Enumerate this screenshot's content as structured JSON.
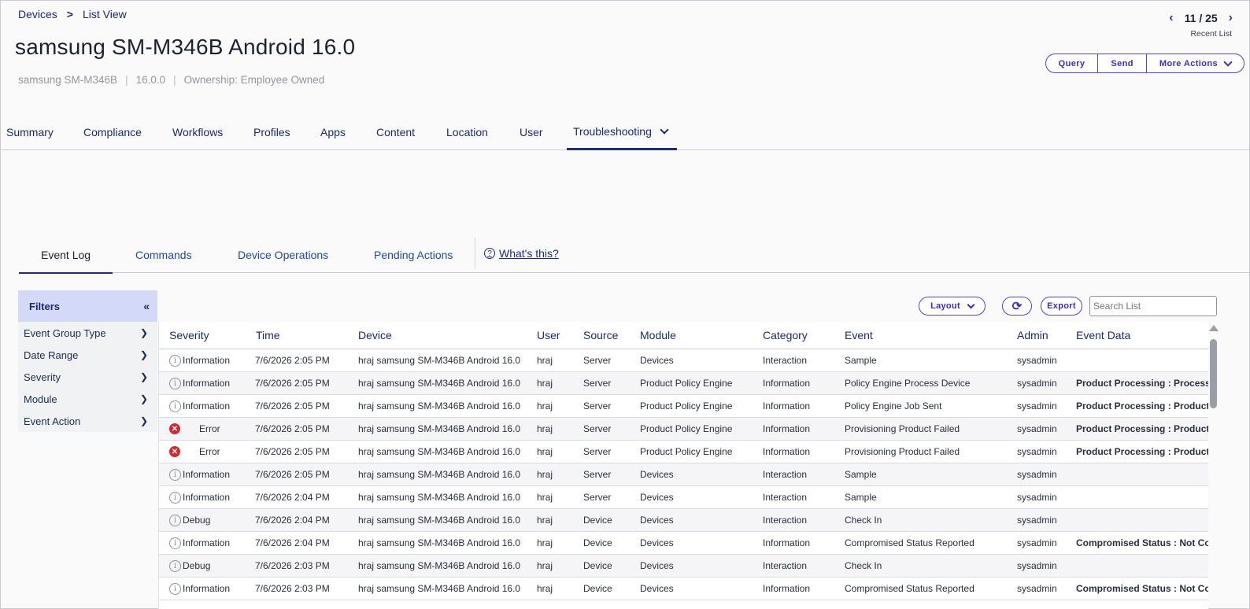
{
  "breadcrumb": {
    "devices": "Devices",
    "separator": ">",
    "list_view": "List View"
  },
  "page_title": "samsung SM-M346B Android 16.0",
  "meta": {
    "model": "samsung SM-M346B",
    "version": "16.0.0",
    "ownership": "Ownership: Employee Owned",
    "separator": "|"
  },
  "pager": {
    "position": "11 / 25",
    "recent": "Recent List"
  },
  "actions": {
    "query": "Query",
    "send": "Send",
    "more": "More Actions"
  },
  "tabs": [
    "Summary",
    "Compliance",
    "Workflows",
    "Profiles",
    "Apps",
    "Content",
    "Location",
    "User",
    "Troubleshooting"
  ],
  "subtabs": [
    "Event Log",
    "Commands",
    "Device Operations",
    "Pending Actions"
  ],
  "whats_this": "What's this?",
  "filters": {
    "title": "Filters",
    "items": [
      "Event Group Type",
      "Date Range",
      "Severity",
      "Module",
      "Event Action"
    ]
  },
  "toolbar": {
    "layout": "Layout",
    "export": "Export",
    "search_placeholder": "Search List"
  },
  "table": {
    "columns": [
      "Severity",
      "Time",
      "Device",
      "User",
      "Source",
      "Module",
      "Category",
      "Event",
      "Admin",
      "Event Data"
    ],
    "rows": [
      {
        "severity": "Information",
        "type": "info",
        "time": "7/6/2026 2:05 PM",
        "device": "hraj samsung SM-M346B Android 16.0",
        "user": "hraj",
        "source": "Server",
        "module": "Devices",
        "category": "Interaction",
        "event": "Sample",
        "admin": "sysadmin",
        "event_data": ""
      },
      {
        "severity": "Information",
        "type": "info",
        "time": "7/6/2026 2:05 PM",
        "device": "hraj samsung SM-M346B Android 16.0",
        "user": "hraj",
        "source": "Server",
        "module": "Product Policy Engine",
        "category": "Information",
        "event": "Policy Engine Process Device",
        "admin": "sysadmin",
        "event_data": "Product Processing : Processing"
      },
      {
        "severity": "Information",
        "type": "info",
        "time": "7/6/2026 2:05 PM",
        "device": "hraj samsung SM-M346B Android 16.0",
        "user": "hraj",
        "source": "Server",
        "module": "Product Policy Engine",
        "category": "Information",
        "event": "Policy Engine Job Sent",
        "admin": "sysadmin",
        "event_data": "Product Processing : ProductID:"
      },
      {
        "severity": "Error",
        "type": "error",
        "time": "7/6/2026 2:05 PM",
        "device": "hraj samsung SM-M346B Android 16.0",
        "user": "hraj",
        "source": "Server",
        "module": "Product Policy Engine",
        "category": "Information",
        "event": "Provisioning Product Failed",
        "admin": "sysadmin",
        "event_data": "Product Processing : Product Ex"
      },
      {
        "severity": "Error",
        "type": "error",
        "time": "7/6/2026 2:05 PM",
        "device": "hraj samsung SM-M346B Android 16.0",
        "user": "hraj",
        "source": "Server",
        "module": "Product Policy Engine",
        "category": "Information",
        "event": "Provisioning Product Failed",
        "admin": "sysadmin",
        "event_data": "Product Processing : Product Ex"
      },
      {
        "severity": "Information",
        "type": "info",
        "time": "7/6/2026 2:05 PM",
        "device": "hraj samsung SM-M346B Android 16.0",
        "user": "hraj",
        "source": "Server",
        "module": "Devices",
        "category": "Interaction",
        "event": "Sample",
        "admin": "sysadmin",
        "event_data": ""
      },
      {
        "severity": "Information",
        "type": "info",
        "time": "7/6/2026 2:04 PM",
        "device": "hraj samsung SM-M346B Android 16.0",
        "user": "hraj",
        "source": "Server",
        "module": "Devices",
        "category": "Interaction",
        "event": "Sample",
        "admin": "sysadmin",
        "event_data": ""
      },
      {
        "severity": "Debug",
        "type": "info",
        "time": "7/6/2026 2:04 PM",
        "device": "hraj samsung SM-M346B Android 16.0",
        "user": "hraj",
        "source": "Device",
        "module": "Devices",
        "category": "Interaction",
        "event": "Check In",
        "admin": "sysadmin",
        "event_data": ""
      },
      {
        "severity": "Information",
        "type": "info",
        "time": "7/6/2026 2:04 PM",
        "device": "hraj samsung SM-M346B Android 16.0",
        "user": "hraj",
        "source": "Device",
        "module": "Devices",
        "category": "Information",
        "event": "Compromised Status Reported",
        "admin": "sysadmin",
        "event_data": "Compromised Status : Not Comp"
      },
      {
        "severity": "Debug",
        "type": "info",
        "time": "7/6/2026 2:03 PM",
        "device": "hraj samsung SM-M346B Android 16.0",
        "user": "hraj",
        "source": "Device",
        "module": "Devices",
        "category": "Interaction",
        "event": "Check In",
        "admin": "sysadmin",
        "event_data": ""
      },
      {
        "severity": "Information",
        "type": "info",
        "time": "7/6/2026 2:03 PM",
        "device": "hraj samsung SM-M346B Android 16.0",
        "user": "hraj",
        "source": "Device",
        "module": "Devices",
        "category": "Information",
        "event": "Compromised Status Reported",
        "admin": "sysadmin",
        "event_data": "Compromised Status : Not Comp"
      }
    ]
  },
  "colors": {
    "accent": "#5a3fd1",
    "nav": "#1a2b6d",
    "error": "#d6262f",
    "filter_header": "#d4d9f7"
  }
}
